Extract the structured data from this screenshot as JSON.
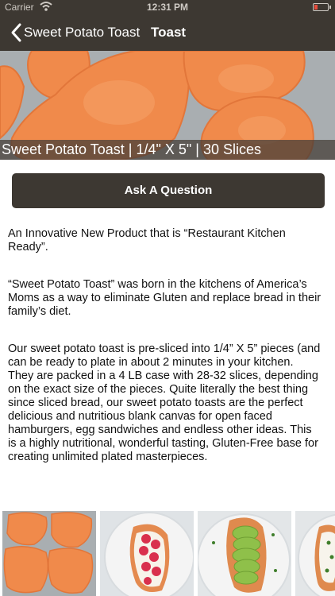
{
  "status_bar": {
    "carrier": "Carrier",
    "time": "12:31 PM",
    "battery_color": "#e74c3c"
  },
  "nav": {
    "back_label": "Sweet Potato Toast",
    "title": "Toast"
  },
  "hero": {
    "caption": "Sweet Potato Toast | 1/4\" X 5\" | 30 Slices"
  },
  "actions": {
    "ask_label": "Ask A Question"
  },
  "description": {
    "p1": "An Innovative New Product that is “Restaurant Kitchen Ready”.",
    "p2": "“Sweet Potato Toast” was born in the kitchens of America’s Moms as a way to eliminate Gluten and replace bread in their family’s diet.",
    "p3": "Our sweet potato toast is pre-sliced into 1/4” X 5” pieces (and can be ready to plate in about 2 minutes in your kitchen. They are packed in a 4 LB case with 28-32 slices, depending on the exact size of the pieces. Quite literally the best thing since sliced bread, our sweet potato toasts are the perfect delicious and nutritious blank canvas for open faced hamburgers, egg sandwiches and endless other ideas. This is a highly nutritional, wonderful tasting, Gluten-Free base for creating unlimited plated masterpieces."
  },
  "gallery": {
    "items": [
      "raw slices",
      "raspberry toast",
      "avocado toast",
      "herb toast"
    ]
  },
  "colors": {
    "bar": "#3d3832",
    "potato": "#f08a4b",
    "tray": "#a7adb0"
  }
}
